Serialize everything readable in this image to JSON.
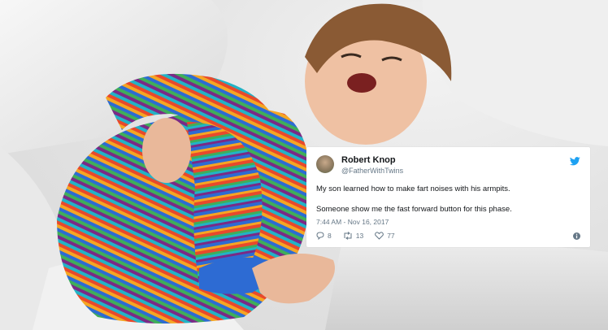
{
  "tweet": {
    "name": "Robert Knop",
    "handle": "@FatherWithTwins",
    "line1": "My son learned how to make fart noises with his armpits.",
    "line2": "Someone show me the fast forward button for this phase.",
    "timestamp": "7:44 AM - Nov 16, 2017",
    "replies": "8",
    "retweets": "13",
    "likes": "77"
  },
  "icons": {
    "avatar": "avatar",
    "bird": "twitter-bird-icon",
    "reply": "reply-icon",
    "retweet": "retweet-icon",
    "like": "heart-icon",
    "info": "info-icon"
  },
  "colors": {
    "twitter_blue": "#1da1f2",
    "meta_gray": "#657786",
    "text": "#14171a"
  }
}
